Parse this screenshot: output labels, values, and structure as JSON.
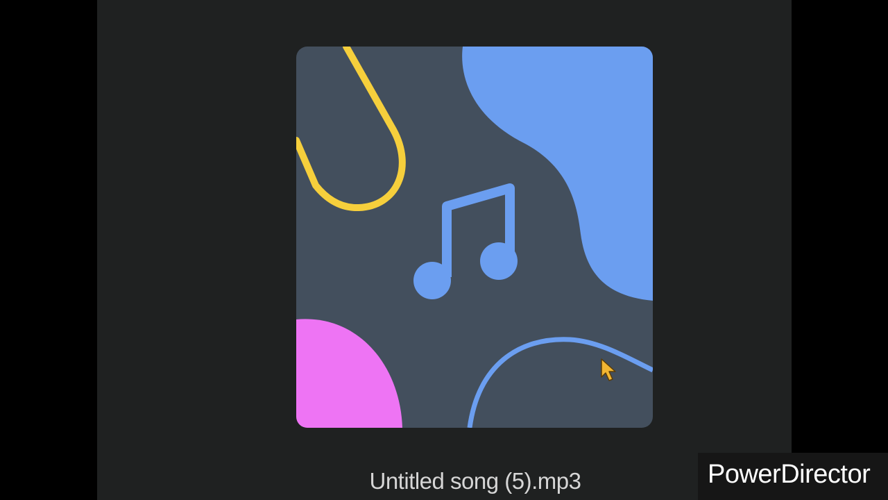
{
  "media": {
    "file_name": "Untitled song (5).mp3",
    "artwork_icon": "music-note-icon"
  },
  "watermark": {
    "text": "PowerDirector"
  },
  "colors": {
    "background": "#000000",
    "panel": "#1f2121",
    "artwork_bg": "#434f5d",
    "accent_blue": "#6b9ef0",
    "accent_yellow": "#f6cf3c",
    "accent_pink": "#ee74f4"
  }
}
